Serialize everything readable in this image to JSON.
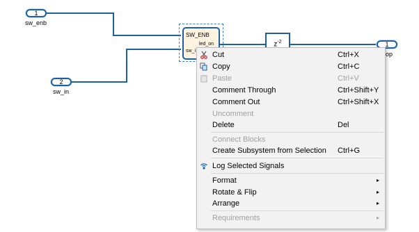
{
  "diagram": {
    "inport1": {
      "number": "1",
      "name": "sw_enb"
    },
    "inport2": {
      "number": "2",
      "name": "sw_in"
    },
    "subsystem": {
      "title": "SW_ENB",
      "output_port": "led_on",
      "input_port": "sw_i"
    },
    "delay": {
      "label": "z",
      "exponent": "-2"
    },
    "outport": {
      "number": "1",
      "name": "op"
    }
  },
  "menu": {
    "cut": {
      "label": "Cut",
      "shortcut": "Ctrl+X"
    },
    "copy": {
      "label": "Copy",
      "shortcut": "Ctrl+C"
    },
    "paste": {
      "label": "Paste",
      "shortcut": "Ctrl+V"
    },
    "comment_through": {
      "label": "Comment Through",
      "shortcut": "Ctrl+Shift+Y"
    },
    "comment_out": {
      "label": "Comment Out",
      "shortcut": "Ctrl+Shift+X"
    },
    "uncomment": {
      "label": "Uncomment"
    },
    "delete": {
      "label": "Delete",
      "shortcut": "Del"
    },
    "connect_blocks": {
      "label": "Connect Blocks"
    },
    "create_subsystem": {
      "label": "Create Subsystem from Selection",
      "shortcut": "Ctrl+G"
    },
    "log_signals": {
      "label": "Log Selected Signals"
    },
    "format": {
      "label": "Format"
    },
    "rotate_flip": {
      "label": "Rotate & Flip"
    },
    "arrange": {
      "label": "Arrange"
    },
    "requirements": {
      "label": "Requirements"
    },
    "submenu_arrow": "▸"
  }
}
